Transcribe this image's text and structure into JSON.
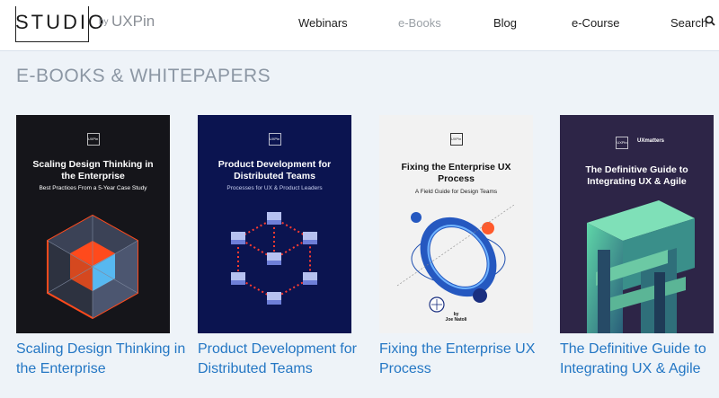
{
  "header": {
    "logo": "STUDIO",
    "logo_by": "by",
    "logo_brand": "UXPin",
    "nav": [
      {
        "label": "Webinars"
      },
      {
        "label": "e-Books"
      },
      {
        "label": "Blog"
      },
      {
        "label": "e-Course"
      },
      {
        "label": "Search"
      }
    ]
  },
  "section": {
    "title": "E-BOOKS & WHITEPAPERS"
  },
  "books": [
    {
      "title": "Scaling Design Thinking in the Enterprise",
      "cover_title": "Scaling Design Thinking in the Enterprise",
      "cover_subtitle": "Best Practices From a 5-Year Case Study",
      "cover_badge": "UXPin",
      "cover_bg": "#15151a"
    },
    {
      "title": "Product Development for Distributed Teams",
      "cover_title": "Product Development for Distributed Teams",
      "cover_subtitle": "Processes for UX & Product Leaders",
      "cover_badge": "UXPin",
      "cover_bg": "#0b1450"
    },
    {
      "title": "Fixing the Enterprise UX Process",
      "cover_title": "Fixing the Enterprise UX Process",
      "cover_subtitle": "A Field Guide for Design Teams",
      "cover_badge": "UXPin",
      "cover_author": "by\nJoe Natoli",
      "cover_bg": "#f2f2f2"
    },
    {
      "title": "The Definitive Guide to Integrating UX & Agile",
      "cover_title": "The Definitive Guide to Integrating UX & Agile",
      "cover_badge": "UXPin",
      "cover_badge2": "UXmatters",
      "cover_bg": "#2d2547"
    }
  ]
}
